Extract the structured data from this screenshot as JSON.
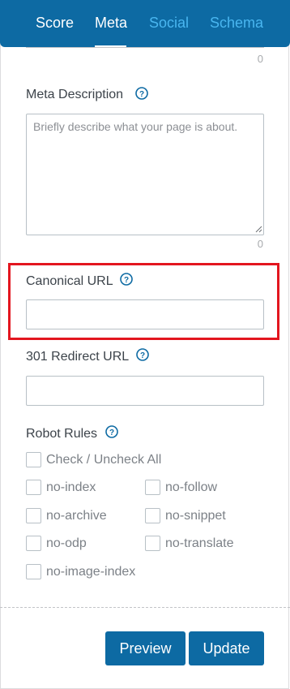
{
  "tabs": [
    {
      "label": "Score",
      "state": "active"
    },
    {
      "label": "Meta",
      "state": "active-selected"
    },
    {
      "label": "Social",
      "state": "inactive"
    },
    {
      "label": "Schema",
      "state": "inactive"
    }
  ],
  "title_counter": "0",
  "meta_description": {
    "label": "Meta Description",
    "placeholder": "Briefly describe what your page is about.",
    "value": "",
    "counter": "0"
  },
  "canonical_url": {
    "label": "Canonical URL",
    "value": ""
  },
  "redirect_url": {
    "label": "301 Redirect URL",
    "value": ""
  },
  "robot_rules": {
    "label": "Robot Rules",
    "check_all": "Check / Uncheck All",
    "options": [
      "no-index",
      "no-follow",
      "no-archive",
      "no-snippet",
      "no-odp",
      "no-translate",
      "no-image-index"
    ]
  },
  "buttons": {
    "preview": "Preview",
    "update": "Update"
  },
  "colors": {
    "tab_bar": "#0d6aa3",
    "tab_inactive": "#49b6f0",
    "highlight": "#e3161f",
    "help_icon": "#0d6aa3"
  }
}
